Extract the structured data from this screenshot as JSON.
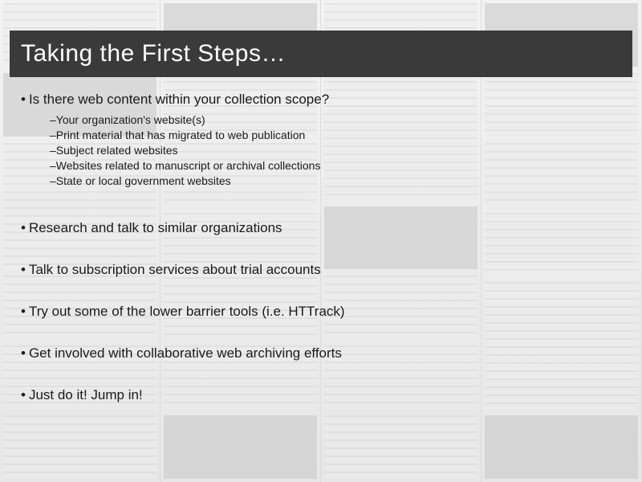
{
  "title": "Taking the First Steps…",
  "bullets": [
    {
      "text": "Is there web content within your collection scope?",
      "sub": [
        "Your organization's website(s)",
        "Print material that has migrated to web publication",
        "Subject related websites",
        "Websites related to manuscript or archival collections",
        "State or local government websites"
      ]
    },
    {
      "text": "Research and talk to similar organizations"
    },
    {
      "text": "Talk to subscription services about trial accounts"
    },
    {
      "text": "Try out some of the lower barrier tools (i.e. HTTrack)"
    },
    {
      "text": "Get involved with collaborative web archiving efforts"
    },
    {
      "text": "Just do it!  Jump in!"
    }
  ]
}
